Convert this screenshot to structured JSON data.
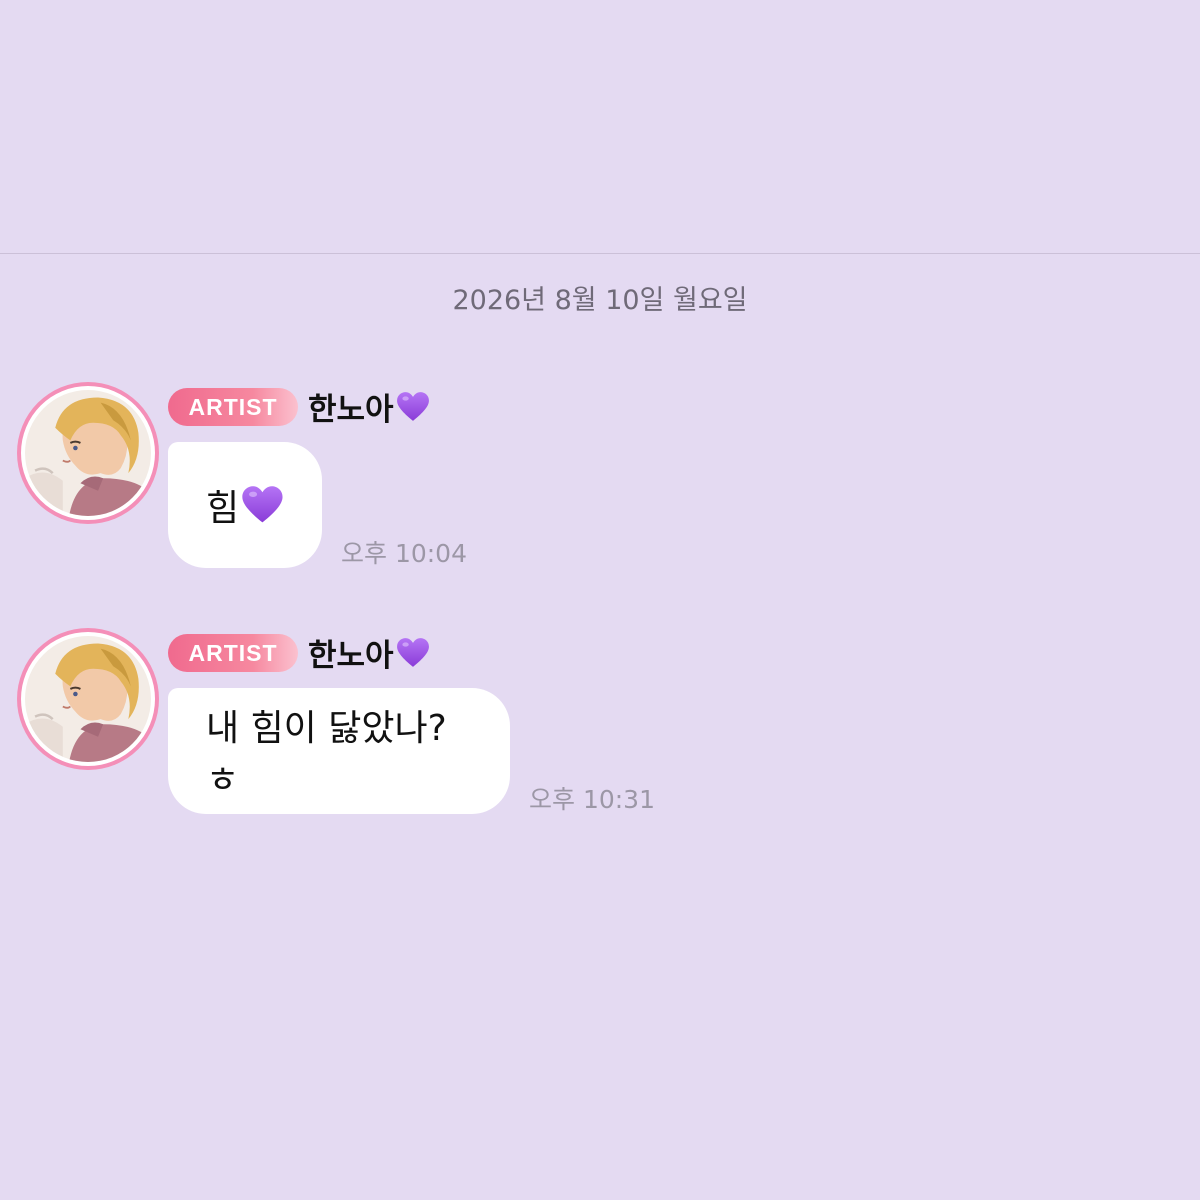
{
  "chat": {
    "date_separator": "2026년 8월 10일 월요일",
    "messages": [
      {
        "badge": "ARTIST",
        "sender": "한노아",
        "sender_emoji": "purple-heart-icon",
        "text": "힘",
        "text_emoji": "purple-heart-icon",
        "time": "오후 10:04"
      },
      {
        "badge": "ARTIST",
        "sender": "한노아",
        "sender_emoji": "purple-heart-icon",
        "text": "내 힘이 닳았나?ㅎ",
        "time": "오후 10:31"
      }
    ]
  },
  "colors": {
    "background": "#e4daf2",
    "badge": "#f06a8e",
    "avatar_ring": "#f48fb8",
    "heart": "#9b4de0"
  }
}
